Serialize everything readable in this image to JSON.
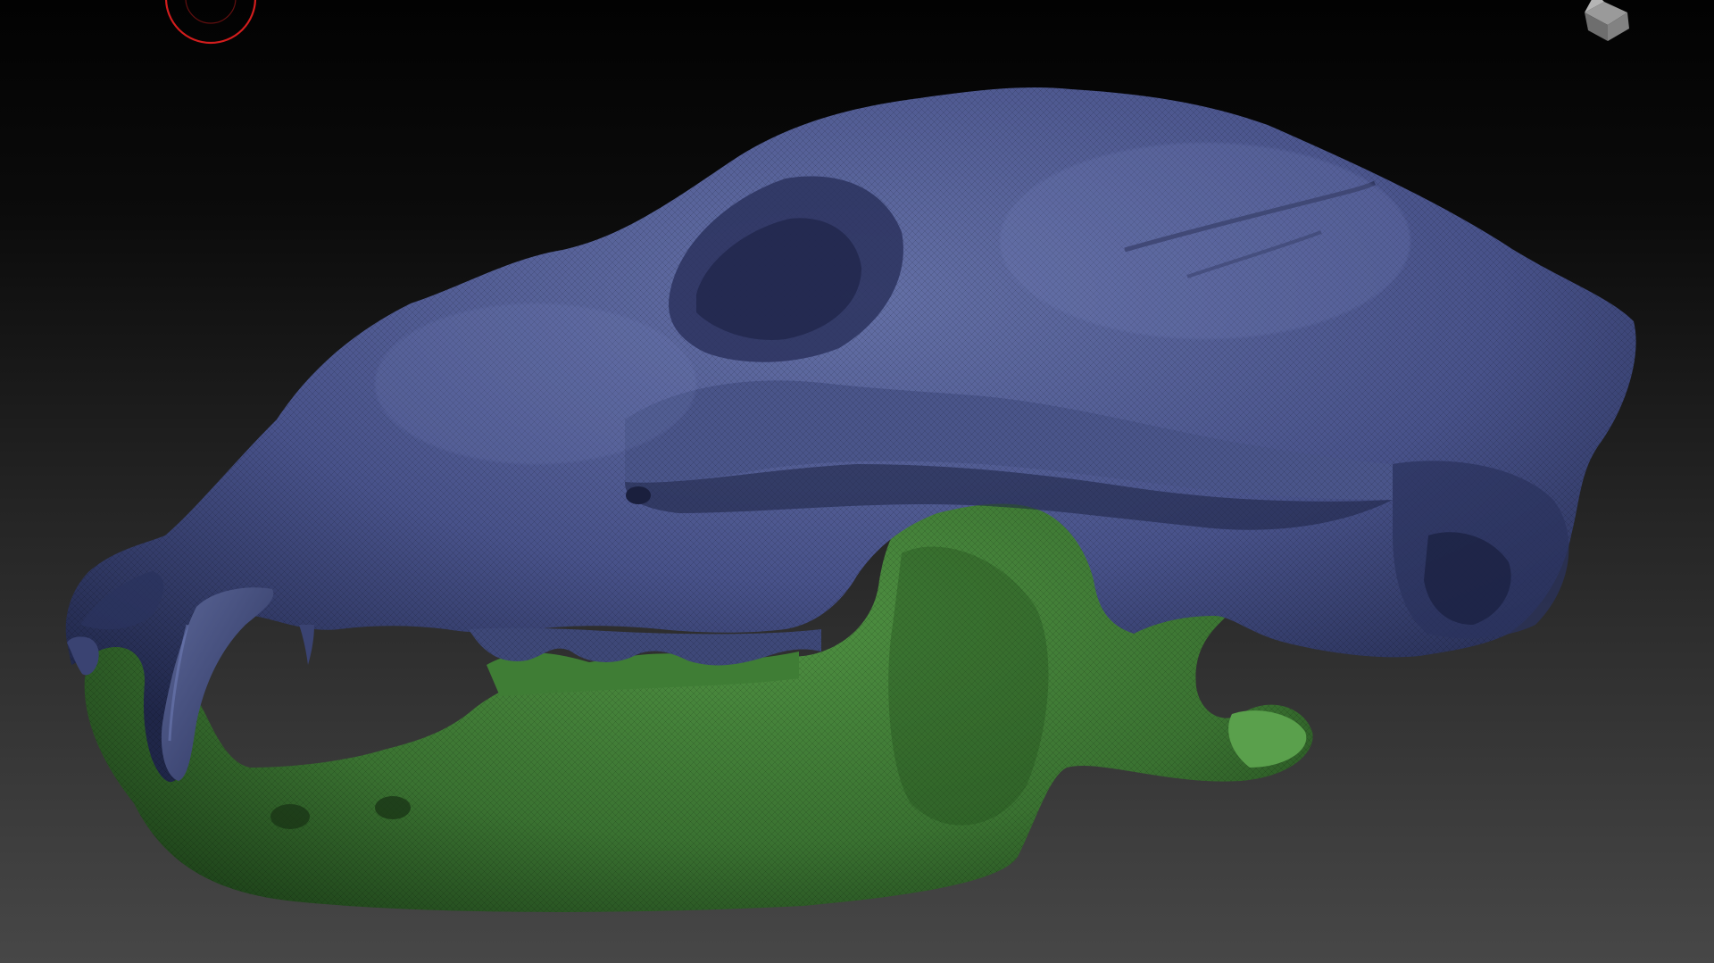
{
  "app": {
    "view": "3d-viewport"
  },
  "viewport": {
    "background_top": "#020202",
    "background_bottom": "#474747"
  },
  "model": {
    "subtools": [
      {
        "part": "cranium",
        "polypaint": "#4a5586"
      },
      {
        "part": "mandible",
        "polypaint": "#3e7a36"
      }
    ],
    "wireframe": true
  },
  "icons": {
    "brush_cursor": "brush-circle-icon",
    "navigation": "view-cube-icon"
  },
  "colors": {
    "brush_ring": "#d21d1d",
    "cranium_light": "#6a77b0",
    "cranium_dark": "#1f2648",
    "mandible_light": "#5fa24f",
    "mandible_dark": "#1c3f18"
  }
}
